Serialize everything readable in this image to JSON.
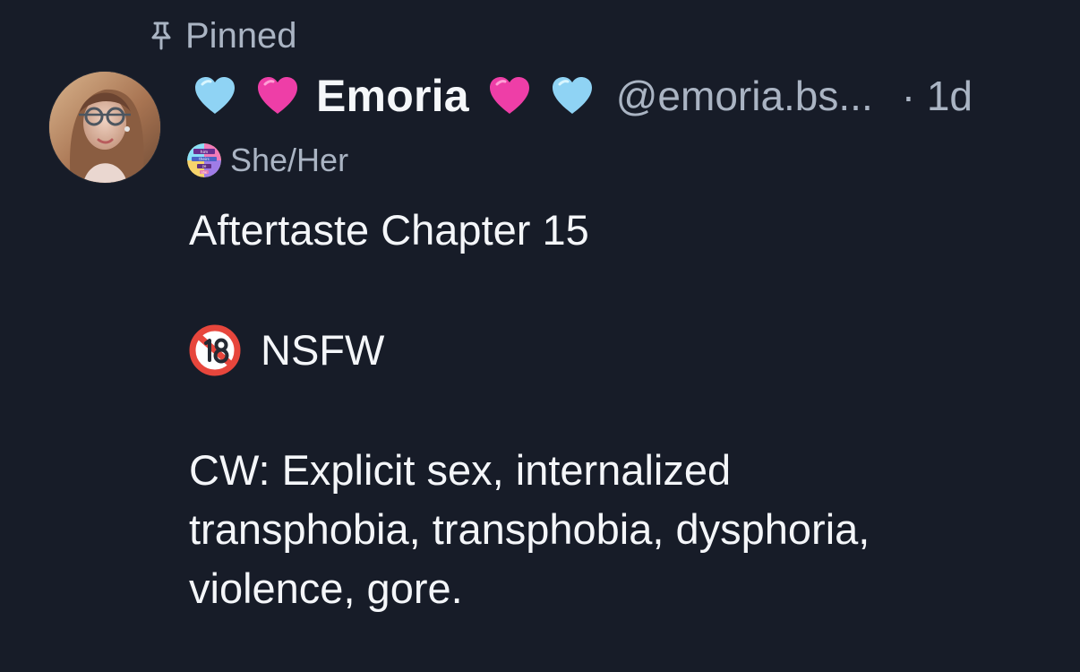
{
  "post": {
    "pinned_label": "Pinned",
    "author": {
      "display_name": "Emoria",
      "handle": "@emoria.bs...",
      "pronouns": "She/Her",
      "heart_icons": [
        "light-blue-heart-icon",
        "pink-heart-icon",
        "pink-heart-icon",
        "light-blue-heart-icon"
      ]
    },
    "timestamp": "· 1d",
    "title_line": "Aftertaste Chapter 15",
    "nsfw_label": "NSFW",
    "cw_lines": [
      "CW: Explicit sex, internalized",
      "transphobia, transphobia, dysphoria,",
      "violence, gore."
    ]
  },
  "pronoun_badge_text": [
    "him",
    "theirs",
    "ze",
    "she"
  ],
  "colors": {
    "background": "#171c28",
    "primary_text": "#f4f6f9",
    "secondary_text": "#aab4c3",
    "light_blue_heart": "#8fd3f4",
    "pink_heart": "#ee3ea7",
    "nsfw_red": "#e7463c"
  }
}
